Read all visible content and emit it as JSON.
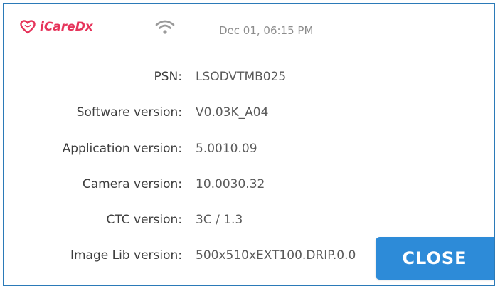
{
  "header": {
    "brand": "iCareDx",
    "datetime": "Dec 01, 06:15 PM",
    "wifi_icon": "wifi-icon",
    "brand_color": "#e6335a"
  },
  "info": {
    "rows": [
      {
        "label": "PSN:",
        "value": "LSODVTMB025"
      },
      {
        "label": "Software version:",
        "value": "V0.03K_A04"
      },
      {
        "label": "Application version:",
        "value": "5.0010.09"
      },
      {
        "label": "Camera version:",
        "value": "10.0030.32"
      },
      {
        "label": "CTC version:",
        "value": "3C / 1.3"
      },
      {
        "label": "Image Lib version:",
        "value": "500x510xEXT100.DRIP.0.0"
      }
    ]
  },
  "actions": {
    "close_label": "CLOSE",
    "accent_color": "#2d8bd8"
  }
}
